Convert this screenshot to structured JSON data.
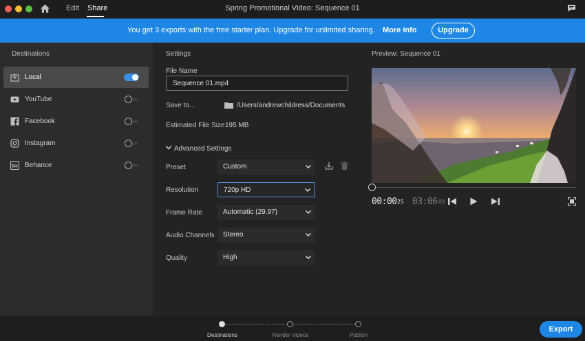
{
  "window": {
    "title": "Spring Promotional Video: Sequence 01",
    "menu": [
      "Edit",
      "Share"
    ],
    "active_menu": "Share"
  },
  "banner": {
    "text": "You get 3 exports with the free starter plan. Upgrade for unlimited sharing.",
    "more_info": "More info",
    "upgrade": "Upgrade",
    "color": "#1e87e5"
  },
  "destinations": {
    "title": "Destinations",
    "items": [
      {
        "label": "Local",
        "icon": "local-export-icon",
        "enabled": true
      },
      {
        "label": "YouTube",
        "icon": "youtube-icon",
        "enabled": false
      },
      {
        "label": "Facebook",
        "icon": "facebook-icon",
        "enabled": false
      },
      {
        "label": "Instagram",
        "icon": "instagram-icon",
        "enabled": false
      },
      {
        "label": "Behance",
        "icon": "behance-icon",
        "enabled": false
      }
    ]
  },
  "settings": {
    "title": "Settings",
    "file_name_label": "File Name",
    "file_name": "Sequence 01.mp4",
    "save_to_label": "Save to...",
    "save_to_path": "/Users/andrewchildress/Documents",
    "file_size_label": "Estimated File Size",
    "file_size": "195 MB",
    "advanced_label": "Advanced Settings",
    "preset_label": "Preset",
    "preset": "Custom",
    "resolution_label": "Resolution",
    "resolution": "720p HD",
    "frame_rate_label": "Frame Rate",
    "frame_rate": "Automatic (29.97)",
    "audio_label": "Audio Channels",
    "audio": "Stereo",
    "quality_label": "Quality",
    "quality": "High"
  },
  "preview": {
    "title": "Preview: Sequence 01",
    "current_time": "00:00",
    "current_frames": "25",
    "duration": "03:06",
    "duration_frames": "09",
    "playhead": 0
  },
  "footer": {
    "steps": [
      "Destinations",
      "Render Videos",
      "Publish"
    ],
    "active_step": 0,
    "export": "Export"
  }
}
